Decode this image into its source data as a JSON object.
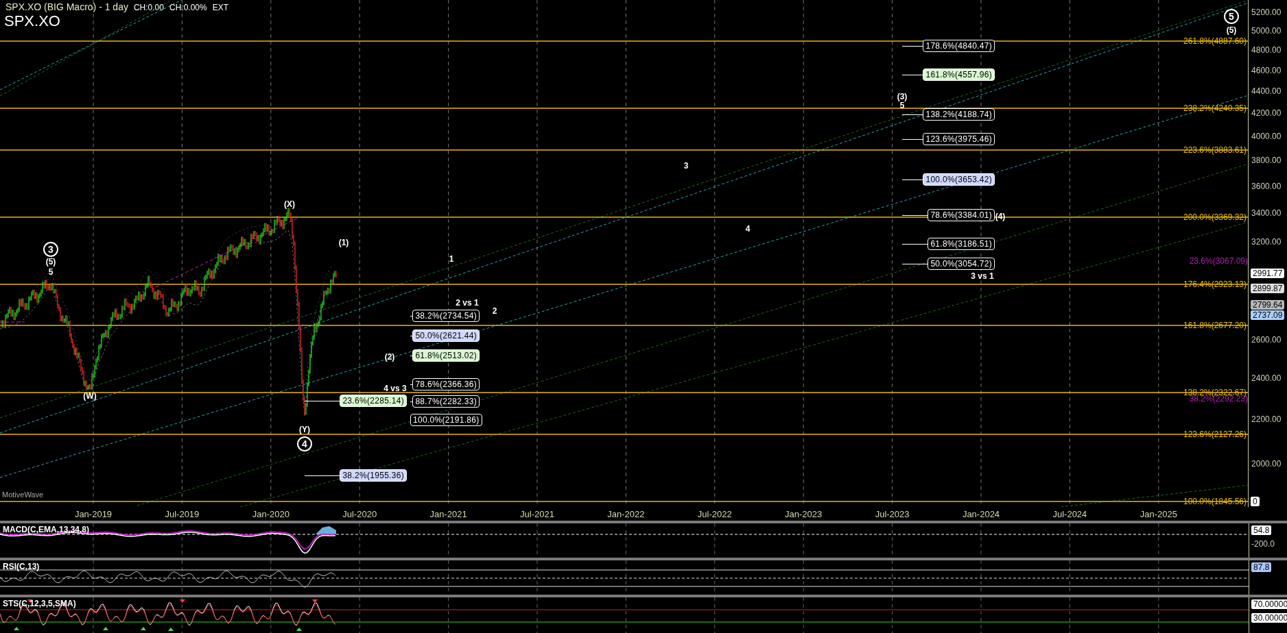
{
  "header": {
    "title": "SPX.XO (BIG Macro) - 1 day",
    "change": "CH:0.00",
    "change_pct": "CH:0.00%",
    "session": "EXT",
    "symbol": "SPX.XO"
  },
  "wave_labels": [
    {
      "text": "3",
      "circled": true
    },
    {
      "text": "(5)",
      "circled": false
    },
    {
      "text": "5",
      "circled": false
    },
    {
      "text": "(W)",
      "circled": false
    },
    {
      "text": "(X)",
      "circled": false
    },
    {
      "text": "(1)",
      "circled": false
    },
    {
      "text": "1",
      "circled": false
    },
    {
      "text": "2 vs 1",
      "circled": false
    },
    {
      "text": "2",
      "circled": false
    },
    {
      "text": "(2)",
      "circled": false
    },
    {
      "text": "4 vs 3",
      "circled": false
    },
    {
      "text": "(Y)",
      "circled": false
    },
    {
      "text": "4",
      "circled": true
    },
    {
      "text": "3",
      "circled": false
    },
    {
      "text": "4",
      "circled": false
    },
    {
      "text": "(3)",
      "circled": false
    },
    {
      "text": "5",
      "circled": false
    },
    {
      "text": "(4)",
      "circled": false
    },
    {
      "text": "3 vs 1",
      "circled": false
    },
    {
      "text": "5",
      "circled": true
    },
    {
      "text": "(5)",
      "circled": false
    }
  ],
  "fib_groups": [
    {
      "levels": [
        {
          "label": "23.6%(2285.14)",
          "color": "#d8f8d0"
        },
        {
          "label": "38.2%(1955.36)",
          "color": "#d0d8ff"
        }
      ]
    },
    {
      "levels": [
        {
          "label": "38.2%(2734.54)",
          "color": "#000000"
        },
        {
          "label": "50.0%(2621.44)",
          "color": "#d0d8ff"
        },
        {
          "label": "61.8%(2513.02)",
          "color": "#d8f8d0"
        },
        {
          "label": "78.6%(2366.36)",
          "color": "#000000"
        },
        {
          "label": "88.7%(2282.33)",
          "color": "#000000"
        },
        {
          "label": "100.0%(2191.86)",
          "color": "#000000"
        }
      ]
    },
    {
      "levels": [
        {
          "label": "178.6%(4840.47)",
          "color": "#000000"
        },
        {
          "label": "161.8%(4557.96)",
          "color": "#d8f8d0"
        },
        {
          "label": "138.2%(4188.74)",
          "color": "#000000"
        },
        {
          "label": "123.6%(3975.46)",
          "color": "#000000"
        },
        {
          "label": "100.0%(3653.42)",
          "color": "#d0d8ff"
        },
        {
          "label": "78.6%(3384.01)",
          "color": "#000000"
        },
        {
          "label": "61.8%(3186.51)",
          "color": "#000000"
        },
        {
          "label": "50.0%(3054.72)",
          "color": "#000000"
        }
      ]
    }
  ],
  "fib_lines": [
    {
      "label": "261.8%(4887.60)"
    },
    {
      "label": "238.2%(4240.35)"
    },
    {
      "label": "223.6%(3883.61)"
    },
    {
      "label": "200.0%(3369.32)"
    },
    {
      "label": "176.4%(2923.13)"
    },
    {
      "label": "161.8%(2677.20)"
    },
    {
      "label": "138.2%(2322.67)"
    },
    {
      "label": "123.6%(2127.26)"
    },
    {
      "label": "100.0%(1845.56)"
    }
  ],
  "retracement_labels": [
    {
      "label": "23.6%(3067.09)"
    },
    {
      "label": "38.2%(2292.23)"
    }
  ],
  "chart_brand": "MotiveWave",
  "price_axis": {
    "ticks": [
      "5200.00",
      "5000.00",
      "4800.00",
      "4600.00",
      "4400.00",
      "4200.00",
      "4000.00",
      "3800.00",
      "3600.00",
      "3400.00",
      "3200.00",
      "2600.00",
      "2400.00",
      "2200.00",
      "2000.00"
    ],
    "tags": [
      {
        "text": "2991.77",
        "color": "#ffffff"
      },
      {
        "text": "2899.87",
        "color": "#e0e0e0"
      },
      {
        "text": "2799.64",
        "color": "#b8b8b8"
      },
      {
        "text": "2737.09",
        "color": "#a8d0ff"
      },
      {
        "text": "0",
        "color": "#ffffff"
      }
    ]
  },
  "time_axis": [
    "Jan-2019",
    "Jul-2019",
    "Jan-2020",
    "Jul-2020",
    "Jan-2021",
    "Jul-2021",
    "Jan-2022",
    "Jul-2022",
    "Jan-2023",
    "Jul-2023",
    "Jan-2024",
    "Jul-2024",
    "Jan-2025"
  ],
  "indicators": [
    {
      "kind": "macd",
      "label": "MACD(C,EMA,13,34,8)",
      "tags": [
        {
          "text": "54.8",
          "color": "#ffffff"
        }
      ],
      "ticks": [
        "-200.0"
      ]
    },
    {
      "kind": "rsi",
      "label": "RSI(C,13)",
      "tags": [
        {
          "text": "87.8",
          "color": "#a8c8ff"
        }
      ]
    },
    {
      "kind": "sts",
      "label": "STS(C,12,3,5,SMA)",
      "tags": [
        {
          "text": "70.00000",
          "color": "#ffffff"
        },
        {
          "text": "30.00000",
          "color": "#ffffff"
        }
      ]
    }
  ]
}
